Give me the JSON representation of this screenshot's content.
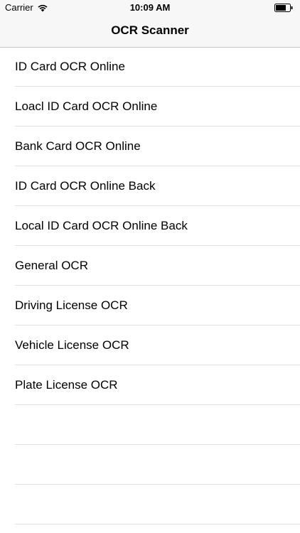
{
  "status_bar": {
    "carrier": "Carrier",
    "time": "10:09 AM",
    "wifi_icon": "wifi-icon",
    "battery_icon": "battery-icon"
  },
  "nav": {
    "title": "OCR Scanner"
  },
  "list": {
    "items": [
      {
        "label": "ID Card OCR Online"
      },
      {
        "label": "Loacl ID Card OCR Online"
      },
      {
        "label": "Bank Card OCR Online"
      },
      {
        "label": "ID Card OCR Online Back"
      },
      {
        "label": "Local ID Card OCR Online Back"
      },
      {
        "label": "General OCR"
      },
      {
        "label": "Driving License OCR"
      },
      {
        "label": "Vehicle License OCR"
      },
      {
        "label": "Plate License OCR"
      }
    ],
    "empty_rows": 3
  },
  "colors": {
    "nav_background": "#f7f7f7",
    "separator": "#e0e0e4",
    "text": "#000000"
  }
}
